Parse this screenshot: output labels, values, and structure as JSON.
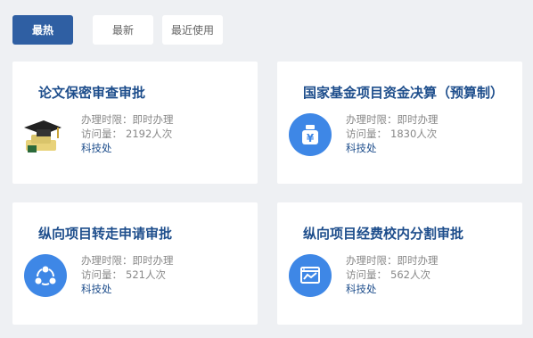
{
  "tabs": [
    {
      "label": "最热"
    },
    {
      "label": "最新"
    },
    {
      "label": "最近使用"
    }
  ],
  "cards": [
    {
      "title": "论文保密审查审批",
      "time_label": "办理时限：",
      "time_value": "即时办理",
      "visits_label": "访问量：",
      "visits_value": "2192人次",
      "dept": "科技处",
      "icon": "graduation-cap-diploma-icon"
    },
    {
      "title": "国家基金项目资金决算（预算制）",
      "time_label": "办理时限：",
      "time_value": "即时办理",
      "visits_label": "访问量：",
      "visits_value": "1830人次",
      "dept": "科技处",
      "icon": "money-bag-yuan-icon"
    },
    {
      "title": "纵向项目转走申请审批",
      "time_label": "办理时限：",
      "time_value": "即时办理",
      "visits_label": "访问量：",
      "visits_value": "521人次",
      "dept": "科技处",
      "icon": "network-nodes-icon"
    },
    {
      "title": "纵向项目经费校内分割审批",
      "time_label": "办理时限：",
      "time_value": "即时办理",
      "visits_label": "访问量：",
      "visits_value": "562人次",
      "dept": "科技处",
      "icon": "browser-chart-icon"
    }
  ],
  "colors": {
    "accent": "#2f5fa3",
    "title": "#1e4e8c",
    "icon_bg": "#3e87e6",
    "page_bg": "#eef0f3"
  }
}
